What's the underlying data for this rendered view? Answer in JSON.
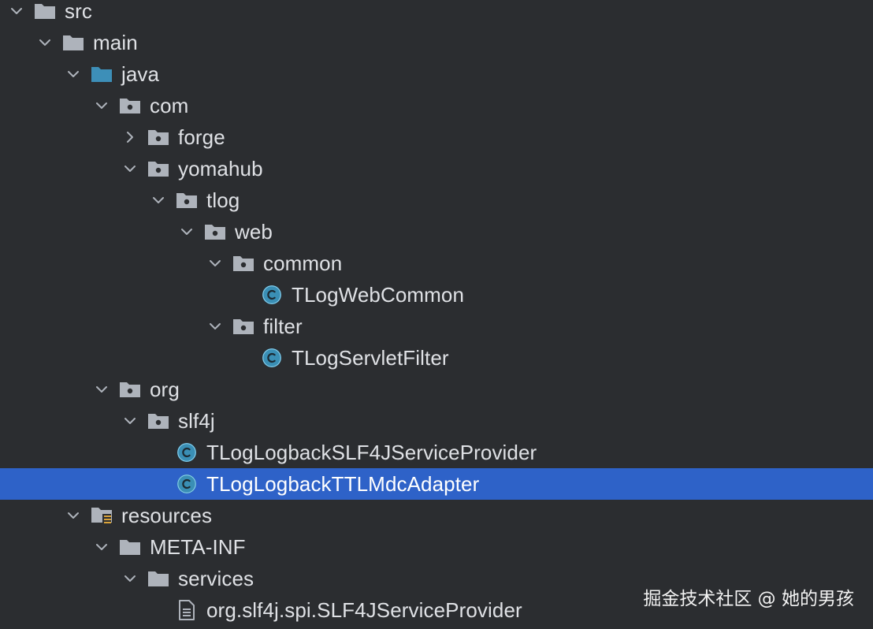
{
  "tree": {
    "items": [
      {
        "label": "src",
        "depth": 0,
        "expanded": true,
        "icon": "folder-icon"
      },
      {
        "label": "main",
        "depth": 1,
        "expanded": true,
        "icon": "folder-icon"
      },
      {
        "label": "java",
        "depth": 2,
        "expanded": true,
        "icon": "source-root-folder-icon"
      },
      {
        "label": "com",
        "depth": 3,
        "expanded": true,
        "icon": "package-icon"
      },
      {
        "label": "forge",
        "depth": 4,
        "expanded": false,
        "icon": "package-icon"
      },
      {
        "label": "yomahub",
        "depth": 4,
        "expanded": true,
        "icon": "package-icon"
      },
      {
        "label": "tlog",
        "depth": 5,
        "expanded": true,
        "icon": "package-icon"
      },
      {
        "label": "web",
        "depth": 6,
        "expanded": true,
        "icon": "package-icon"
      },
      {
        "label": "common",
        "depth": 7,
        "expanded": true,
        "icon": "package-icon"
      },
      {
        "label": "TLogWebCommon",
        "depth": 8,
        "icon": "java-class-icon"
      },
      {
        "label": "filter",
        "depth": 7,
        "expanded": true,
        "icon": "package-icon"
      },
      {
        "label": "TLogServletFilter",
        "depth": 8,
        "icon": "java-class-icon"
      },
      {
        "label": "org",
        "depth": 3,
        "expanded": true,
        "icon": "package-icon"
      },
      {
        "label": "slf4j",
        "depth": 4,
        "expanded": true,
        "icon": "package-icon"
      },
      {
        "label": "TLogLogbackSLF4JServiceProvider",
        "depth": 5,
        "icon": "java-class-icon"
      },
      {
        "label": "TLogLogbackTTLMdcAdapter",
        "depth": 5,
        "icon": "java-class-icon",
        "selected": true
      },
      {
        "label": "resources",
        "depth": 2,
        "expanded": true,
        "icon": "resources-folder-icon"
      },
      {
        "label": "META-INF",
        "depth": 3,
        "expanded": true,
        "icon": "folder-icon"
      },
      {
        "label": "services",
        "depth": 4,
        "expanded": true,
        "icon": "folder-icon"
      },
      {
        "label": "org.slf4j.spi.SLF4JServiceProvider",
        "depth": 5,
        "icon": "text-file-icon"
      }
    ]
  },
  "watermark": "掘金技术社区 @ 她的男孩",
  "colors": {
    "background": "#2b2d30",
    "text": "#dfe1e5",
    "selection": "#2e62c8",
    "folder": "#aeb3bb",
    "source_root_folder": "#3d8fb8",
    "class_icon_fill": "#3a8fb5",
    "chevron": "#aeb3bb"
  }
}
